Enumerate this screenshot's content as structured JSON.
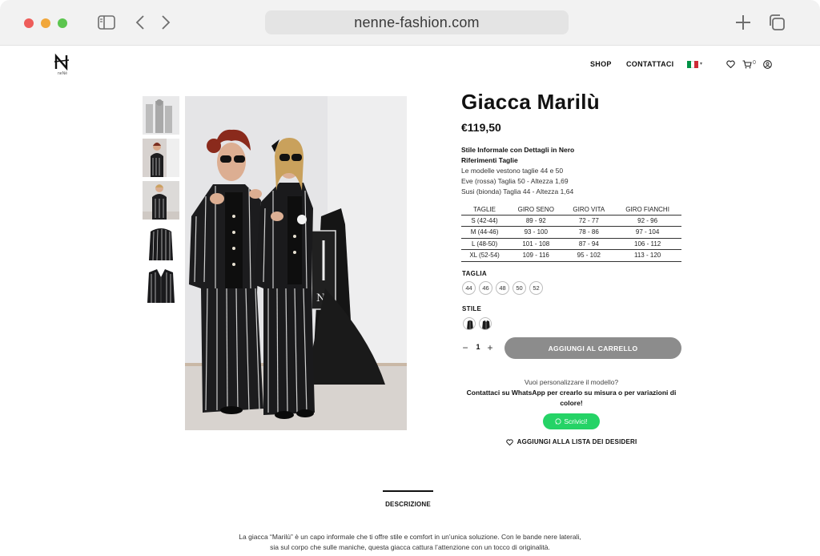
{
  "browser": {
    "url": "nenne-fashion.com",
    "traffic_colors": {
      "close": "#ee5d5a",
      "minimize": "#f1a73b",
      "zoom": "#5cc54f"
    },
    "icons": [
      "sidebar-icon",
      "back-chevron-icon",
      "forward-chevron-icon",
      "plus-icon",
      "tabs-icon"
    ]
  },
  "header": {
    "logo_sub": "neNè",
    "nav": {
      "shop": "SHOP",
      "contatti": "CONTATTACI"
    },
    "cart_count": "0",
    "flag_colors": [
      "#009246",
      "#ffffff",
      "#ce2b37"
    ],
    "icons": [
      "heart-icon",
      "cart-icon",
      "user-icon"
    ]
  },
  "product": {
    "title": "Giacca Marilù",
    "price": "€119,50",
    "desc": {
      "line1": "Stile Informale con Dettagli in Nero",
      "line2": "Riferimenti Taglie",
      "line3": "Le modelle vestono taglie 44 e 50",
      "line4": "Eve (rossa) Taglia 50 - Altezza 1,69",
      "line5": "Susi (bionda) Taglia 44 - Altezza 1,64"
    },
    "table": {
      "headers": [
        "TAGLIE",
        "GIRO SENO",
        "GIRO VITA",
        "GIRO FIANCHI"
      ],
      "rows": [
        [
          "S (42-44)",
          "89 - 92",
          "72 - 77",
          "92 - 96"
        ],
        [
          "M (44-46)",
          "93 - 100",
          "78 - 86",
          "97 - 104"
        ],
        [
          "L (48-50)",
          "101 - 108",
          "87 - 94",
          "106 - 112"
        ],
        [
          "XL (52-54)",
          "109 - 116",
          "95 - 102",
          "113 - 120"
        ]
      ]
    },
    "size_label": "TAGLIA",
    "sizes": [
      "44",
      "46",
      "48",
      "50",
      "52"
    ],
    "style_label": "STILE",
    "quantity": "1",
    "qty_minus": "−",
    "qty_plus": "+",
    "add_to_cart": "AGGIUNGI AL CARRELLO",
    "custom_question": "Vuoi personalizzare il modello?",
    "custom_text": "Contattaci su WhatsApp per crearlo su misura o per variazioni di colore!",
    "whatsapp_label": "Scrivici!",
    "whatsapp_color": "#25d366",
    "wishlist": "AGGIUNGI ALLA LISTA DEI DESIDERI"
  },
  "tabs": {
    "description": "DESCRIZIONE"
  },
  "description": {
    "line1": "La giacca “Marilù” è un capo informale che ti offre stile e comfort in un’unica soluzione. Con le bande nere laterali,",
    "line2": "sia sul corpo che sulle maniche, questa giacca cattura l’attenzione con un tocco di originalità."
  }
}
